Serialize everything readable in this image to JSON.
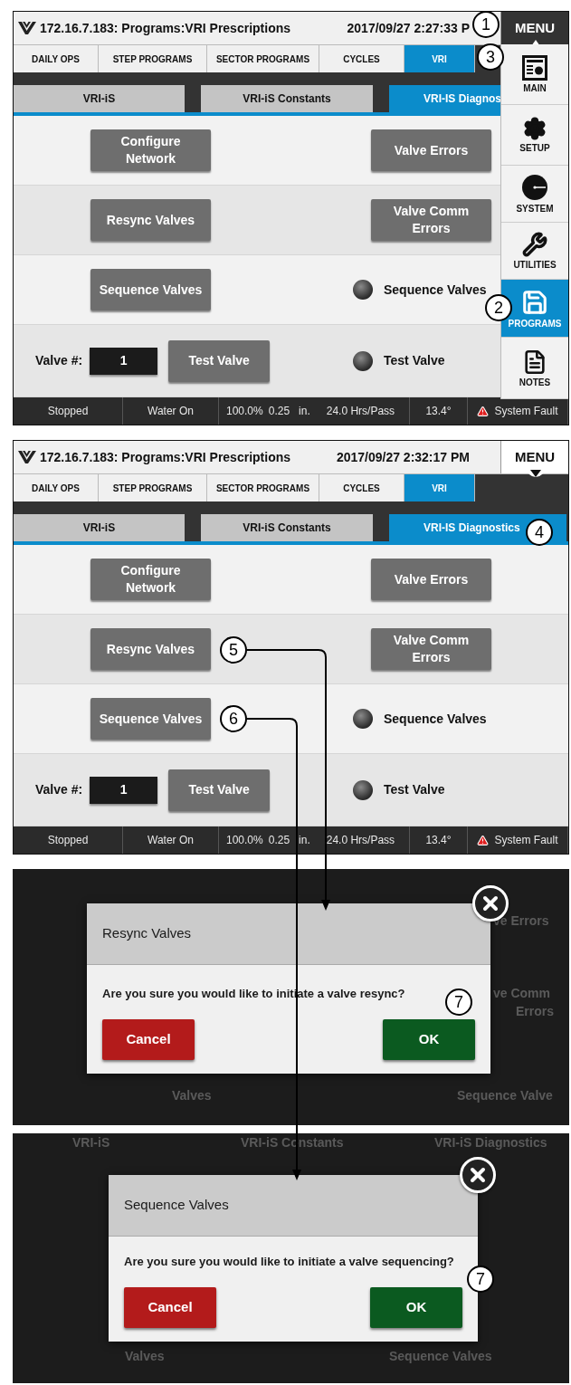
{
  "screens": [
    {
      "header": {
        "title": "172.16.7.183: Programs:VRI Prescriptions",
        "datetime": "2017/09/27 2:27:33 P",
        "menu": {
          "label": "MENU",
          "expanded": true
        }
      },
      "tabs": [
        {
          "label": "DAILY OPS",
          "selected": false
        },
        {
          "label": "STEP PROGRAMS",
          "selected": false
        },
        {
          "label": "SECTOR PROGRAMS",
          "selected": false
        },
        {
          "label": "CYCLES",
          "selected": false
        },
        {
          "label": "VRI",
          "selected": true
        }
      ],
      "subtabs": [
        {
          "label": "VRI-iS",
          "selected": false
        },
        {
          "label": "VRI-iS Constants",
          "selected": false
        },
        {
          "label": "VRI-IS Diagnos",
          "selected": true
        }
      ],
      "rows": [
        {
          "left": [
            {
              "kind": "button",
              "label": "Configure Network"
            }
          ],
          "right": [
            {
              "kind": "button",
              "label": "Valve Errors"
            }
          ]
        },
        {
          "left": [
            {
              "kind": "button",
              "label": "Resync Valves"
            }
          ],
          "right": [
            {
              "kind": "button",
              "label": "Valve Comm Errors"
            }
          ]
        },
        {
          "left": [
            {
              "kind": "button",
              "label": "Sequence Valves"
            }
          ],
          "right": [
            {
              "kind": "indicator",
              "label": "Sequence Valves"
            }
          ]
        },
        {
          "left": [
            {
              "kind": "label",
              "label": "Valve #:"
            },
            {
              "kind": "field",
              "value": "1"
            },
            {
              "kind": "button",
              "label": "Test Valve"
            }
          ],
          "right": [
            {
              "kind": "indicator",
              "label": "Test Valve"
            }
          ]
        }
      ],
      "status_bar": [
        {
          "texts": [
            "Stopped"
          ],
          "alert": false
        },
        {
          "texts": [
            "Water On"
          ],
          "alert": false
        },
        {
          "texts": [
            "100.0%",
            "0.25",
            "in.",
            "24.0 Hrs/Pass"
          ],
          "alert": false
        },
        {
          "texts": [
            "13.4°"
          ],
          "alert": false
        },
        {
          "texts": [
            "System Fault"
          ],
          "alert": true
        }
      ],
      "side_menu": [
        {
          "kind": "main",
          "label": "MAIN",
          "selected": false
        },
        {
          "kind": "setup",
          "label": "SETUP",
          "selected": false
        },
        {
          "kind": "system",
          "label": "SYSTEM",
          "selected": false
        },
        {
          "kind": "utilities",
          "label": "UTILITIES",
          "selected": false
        },
        {
          "kind": "programs",
          "label": "PROGRAMS",
          "selected": true
        },
        {
          "kind": "notes",
          "label": "NOTES",
          "selected": false
        }
      ]
    },
    {
      "header": {
        "title": "172.16.7.183: Programs:VRI Prescriptions",
        "datetime": "2017/09/27 2:32:17 PM",
        "menu": {
          "label": "MENU",
          "expanded": false
        }
      },
      "tabs": [
        {
          "label": "DAILY OPS",
          "selected": false
        },
        {
          "label": "STEP PROGRAMS",
          "selected": false
        },
        {
          "label": "SECTOR PROGRAMS",
          "selected": false
        },
        {
          "label": "CYCLES",
          "selected": false
        },
        {
          "label": "VRI",
          "selected": true
        }
      ],
      "subtabs": [
        {
          "label": "VRI-iS",
          "selected": false
        },
        {
          "label": "VRI-iS Constants",
          "selected": false
        },
        {
          "label": "VRI-IS Diagnostics",
          "selected": true
        }
      ],
      "rows": [
        {
          "left": [
            {
              "kind": "button",
              "label": "Configure Network"
            }
          ],
          "right": [
            {
              "kind": "button",
              "label": "Valve Errors"
            }
          ]
        },
        {
          "left": [
            {
              "kind": "button",
              "label": "Resync Valves"
            }
          ],
          "right": [
            {
              "kind": "button",
              "label": "Valve Comm Errors"
            }
          ]
        },
        {
          "left": [
            {
              "kind": "button",
              "label": "Sequence Valves"
            }
          ],
          "right": [
            {
              "kind": "indicator",
              "label": "Sequence Valves"
            }
          ]
        },
        {
          "left": [
            {
              "kind": "label",
              "label": "Valve #:"
            },
            {
              "kind": "field",
              "value": "1"
            },
            {
              "kind": "button",
              "label": "Test Valve"
            }
          ],
          "right": [
            {
              "kind": "indicator",
              "label": "Test Valve"
            }
          ]
        }
      ],
      "status_bar": [
        {
          "texts": [
            "Stopped"
          ],
          "alert": false
        },
        {
          "texts": [
            "Water On"
          ],
          "alert": false
        },
        {
          "texts": [
            "100.0%",
            "0.25",
            "in.",
            "24.0 Hrs/Pass"
          ],
          "alert": false
        },
        {
          "texts": [
            "13.4°"
          ],
          "alert": false
        },
        {
          "texts": [
            "System Fault"
          ],
          "alert": true
        }
      ]
    }
  ],
  "dialogs": [
    {
      "backdrop_texts": [
        "ve Errors",
        "ve Comm",
        "Errors",
        "Valves",
        "Sequence Valve"
      ],
      "title": "Resync Valves",
      "message": "Are you sure you would like to initiate a valve resync?",
      "buttons": [
        {
          "kind": "cancel",
          "label": "Cancel"
        },
        {
          "kind": "ok",
          "label": "OK"
        }
      ]
    },
    {
      "backdrop_texts": [
        "VRI-iS",
        "VRI-iS Constants",
        "VRI-iS Diagnostics",
        "Valves",
        "Sequence Valves"
      ],
      "title": "Sequence Valves",
      "message": "Are you sure you would like to initiate a valve sequencing?",
      "buttons": [
        {
          "kind": "cancel",
          "label": "Cancel"
        },
        {
          "kind": "ok",
          "label": "OK"
        }
      ]
    }
  ],
  "callouts": [
    {
      "label": "1"
    },
    {
      "label": "3"
    },
    {
      "label": "2"
    },
    {
      "label": "4"
    },
    {
      "label": "5"
    },
    {
      "label": "6"
    },
    {
      "label": "7"
    },
    {
      "label": "7"
    }
  ]
}
